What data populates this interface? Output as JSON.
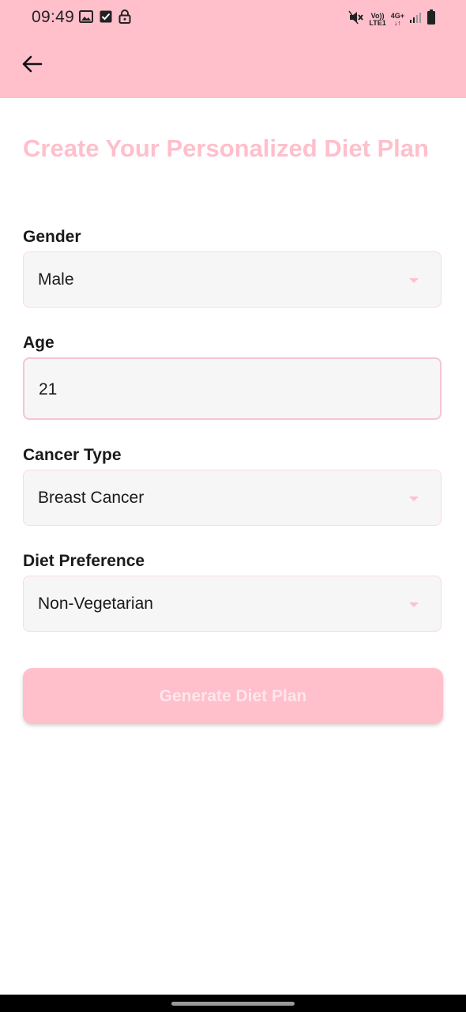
{
  "status_bar": {
    "time": "09:49",
    "network_top": "Vo))",
    "network_bottom": "LTE1",
    "network_type": "4G+"
  },
  "app_bar": {
    "back_icon": "arrow-left-icon"
  },
  "page": {
    "title": "Create Your Personalized Diet Plan"
  },
  "form": {
    "gender": {
      "label": "Gender",
      "value": "Male"
    },
    "age": {
      "label": "Age",
      "value": "21"
    },
    "cancer_type": {
      "label": "Cancer Type",
      "value": "Breast Cancer"
    },
    "diet_preference": {
      "label": "Diet Preference",
      "value": "Non-Vegetarian"
    }
  },
  "actions": {
    "generate_label": "Generate Diet Plan"
  },
  "colors": {
    "accent": "#ffbfcb",
    "field_bg": "#f6f6f6",
    "field_border": "#fbd9df"
  }
}
